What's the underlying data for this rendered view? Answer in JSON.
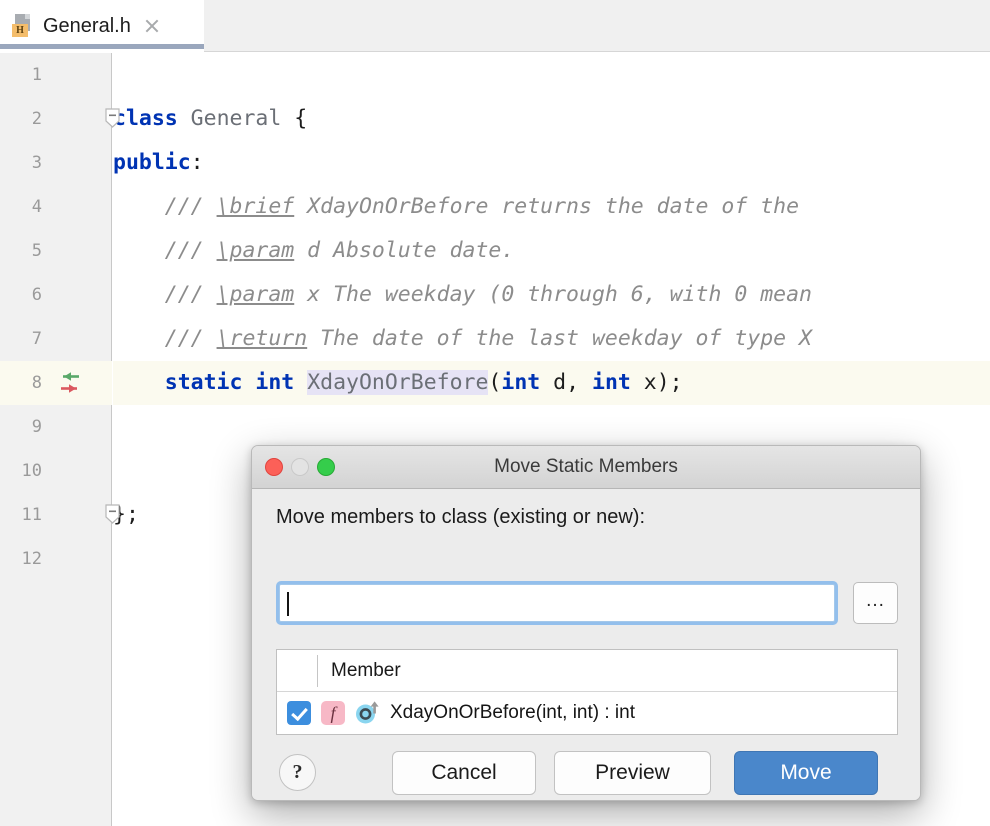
{
  "tab": {
    "title": "General.h",
    "icon": "header-file-icon",
    "badge": "H",
    "close_icon": "close-icon"
  },
  "editor": {
    "lines": [
      {
        "number": "1",
        "text": ""
      },
      {
        "number": "2",
        "text": "class General {"
      },
      {
        "number": "3",
        "text": "public:"
      },
      {
        "number": "4",
        "text": "    /// \\brief XdayOnOrBefore returns the date of the"
      },
      {
        "number": "5",
        "text": "    /// \\param d Absolute date."
      },
      {
        "number": "6",
        "text": "    /// \\param x The weekday (0 through 6, with 0 mean"
      },
      {
        "number": "7",
        "text": "    /// \\return The date of the last weekday of type X"
      },
      {
        "number": "8",
        "text": "    static int XdayOnOrBefore(int d, int x);"
      },
      {
        "number": "9",
        "text": ""
      },
      {
        "number": "10",
        "text": ""
      },
      {
        "number": "11",
        "text": "};"
      },
      {
        "number": "12",
        "text": ""
      }
    ],
    "fragments": {
      "kw_class": "class",
      "name_general": " General ",
      "brace_open": "{",
      "kw_public": "public",
      "colon": ":",
      "indent": "    ",
      "cmt_slashes": "/// ",
      "tag_brief": "\\brief",
      "brief_rest": " XdayOnOrBefore returns the date of the",
      "tag_param1": "\\param",
      "param1_rest": " d Absolute date.",
      "tag_param2": "\\param",
      "param2_rest": " x The weekday (0 through 6, with 0 mean",
      "tag_return": "\\return",
      "return_rest": " The date of the last weekday of type X",
      "kw_static": "static",
      "space": " ",
      "kw_int": "int",
      "sel_name": "XdayOnOrBefore",
      "sig_paren_open": "(",
      "kw_int2": "int",
      "arg_d": " d, ",
      "kw_int3": "int",
      "arg_x": " x);",
      "close_brace": "};"
    },
    "gutter": {
      "fold_class_icon": "fold-collapse-icon",
      "fold_end_icon": "fold-collapse-icon",
      "nav_icon": "implemented-declared-arrows-icon"
    }
  },
  "dialog": {
    "title": "Move Static Members",
    "window_controls": {
      "close": "close-traffic-light",
      "minimize": "minimize-traffic-light",
      "zoom": "zoom-traffic-light"
    },
    "target_label": "Move members to class (existing or new):",
    "target_input": {
      "value": "",
      "placeholder": ""
    },
    "browse_button": "...",
    "table": {
      "headers": [
        "",
        "Member"
      ],
      "rows": [
        {
          "checked": true,
          "checkbox_icon": "checkbox-checked-icon",
          "kind_icon": "function-badge-icon",
          "kind_letter": "f",
          "static_icon": "static-member-icon",
          "label": "XdayOnOrBefore(int, int) : int"
        }
      ]
    },
    "buttons": {
      "help": "?",
      "cancel": "Cancel",
      "preview": "Preview",
      "move": "Move"
    }
  },
  "colors": {
    "accent_blue": "#4a87cb",
    "focus_ring": "#93bfec",
    "tab_underline": "#9aa7bd",
    "highlight_line": "#fbfaef",
    "selection": "#e6e3f5",
    "keyword": "#0033b3",
    "comment": "#8c8c8c",
    "checkbox": "#3c8ede",
    "function_badge": "#f7b8c6",
    "static_icon": "#8ad5ef",
    "header_badge": "#f4bd6b",
    "nav_green": "#59a869",
    "nav_red": "#db5860"
  }
}
